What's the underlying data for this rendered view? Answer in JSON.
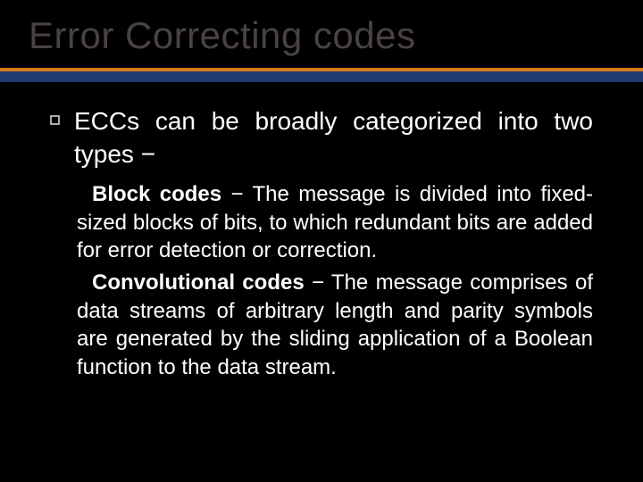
{
  "title": "Error Correcting codes",
  "intro": "ECCs can be broadly categorized into two types −",
  "items": [
    {
      "label": "Block codes",
      "desc": " − The message is divided into fixed-sized blocks of bits, to which redundant bits are added for error detection or correction."
    },
    {
      "label": "Convolutional codes",
      "desc": " − The message comprises of data streams of arbitrary length and parity symbols are generated by the sliding application of a Boolean function to the data stream."
    }
  ]
}
